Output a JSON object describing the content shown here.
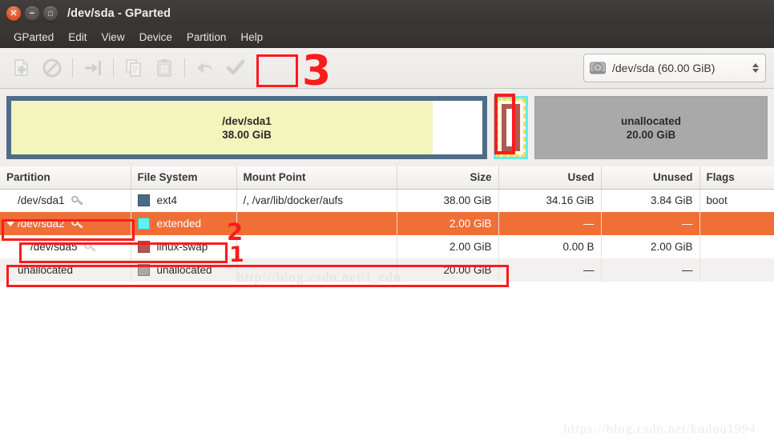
{
  "window": {
    "title": "/dev/sda - GParted",
    "controls": [
      {
        "name": "close",
        "glyph": "✕"
      },
      {
        "name": "minimize",
        "glyph": "−"
      },
      {
        "name": "maximize",
        "glyph": "□"
      }
    ]
  },
  "menubar": {
    "items": [
      {
        "label": "GParted"
      },
      {
        "label": "Edit"
      },
      {
        "label": "View"
      },
      {
        "label": "Device"
      },
      {
        "label": "Partition"
      },
      {
        "label": "Help"
      }
    ]
  },
  "toolbar": {
    "buttons": [
      {
        "name": "new-partition-icon",
        "tooltip": "New"
      },
      {
        "name": "delete-partition-icon",
        "tooltip": "Delete"
      },
      {
        "name": "resize-move-icon",
        "tooltip": "Resize/Move"
      },
      {
        "name": "copy-icon",
        "tooltip": "Copy"
      },
      {
        "name": "paste-icon",
        "tooltip": "Paste"
      },
      {
        "name": "undo-icon",
        "tooltip": "Undo"
      },
      {
        "name": "apply-icon",
        "tooltip": "Apply All Operations"
      }
    ],
    "device_selector": {
      "icon": "hard-disk-icon",
      "label": "/dev/sda  (60.00 GiB)"
    }
  },
  "disk_graphic": {
    "partitions": [
      {
        "name": "/dev/sda1",
        "size": "38.00 GiB",
        "border_color": "#4f6d89",
        "fill_color": "#f4f4bd",
        "used_percent": 89.5
      },
      {
        "name": "/dev/sda2",
        "size": "2.00 GiB",
        "border_color": "#60ecf4",
        "selected": true,
        "child": {
          "name": "/dev/sda5",
          "size": "2.00 GiB",
          "border_color": "#b0584f"
        }
      },
      {
        "name": "unallocated",
        "size": "20.00 GiB",
        "fill_color": "#a9a9a9"
      }
    ]
  },
  "table": {
    "columns": [
      {
        "key": "partition",
        "label": "Partition",
        "align": "left"
      },
      {
        "key": "filesystem",
        "label": "File System",
        "align": "left"
      },
      {
        "key": "mountpoint",
        "label": "Mount Point",
        "align": "left"
      },
      {
        "key": "size",
        "label": "Size",
        "align": "right"
      },
      {
        "key": "used",
        "label": "Used",
        "align": "right"
      },
      {
        "key": "unused",
        "label": "Unused",
        "align": "right"
      },
      {
        "key": "flags",
        "label": "Flags",
        "align": "left"
      }
    ],
    "rows": [
      {
        "partition": "/dev/sda1",
        "filesystem": "ext4",
        "swatch": "#4a6a87",
        "mountpoint": "/, /var/lib/docker/aufs",
        "size": "38.00 GiB",
        "used": "34.16 GiB",
        "unused": "3.84 GiB",
        "flags": "boot",
        "selected": false,
        "expander": false,
        "indent": false,
        "key_icon": true
      },
      {
        "partition": "/dev/sda2",
        "filesystem": "extended",
        "swatch": "#5ff0f0",
        "mountpoint": "",
        "size": "2.00 GiB",
        "used": "—",
        "unused": "—",
        "flags": "",
        "selected": true,
        "expander": true,
        "indent": false,
        "key_icon": true
      },
      {
        "partition": "/dev/sda5",
        "filesystem": "linux-swap",
        "swatch": "#b4574f",
        "mountpoint": "",
        "size": "2.00 GiB",
        "used": "0.00 B",
        "unused": "2.00 GiB",
        "flags": "",
        "selected": false,
        "expander": false,
        "indent": true,
        "key_icon": true
      },
      {
        "partition": "unallocated",
        "filesystem": "unallocated",
        "swatch": "#a8a8a8",
        "mountpoint": "",
        "size": "20.00 GiB",
        "used": "—",
        "unused": "—",
        "flags": "",
        "selected": false,
        "expander": false,
        "indent": false,
        "key_icon": false
      }
    ]
  },
  "watermarks": {
    "row": "http://blog.csdn.net/l_edu",
    "bottom": "https://blog.csdn.net/kudou1994"
  },
  "annotations": {
    "color": "#fc1b1b",
    "numbers": [
      {
        "label": "3",
        "target": "apply-button"
      },
      {
        "label": "2",
        "target": "sda2-row"
      },
      {
        "label": "1",
        "target": "sda5-row"
      }
    ]
  }
}
